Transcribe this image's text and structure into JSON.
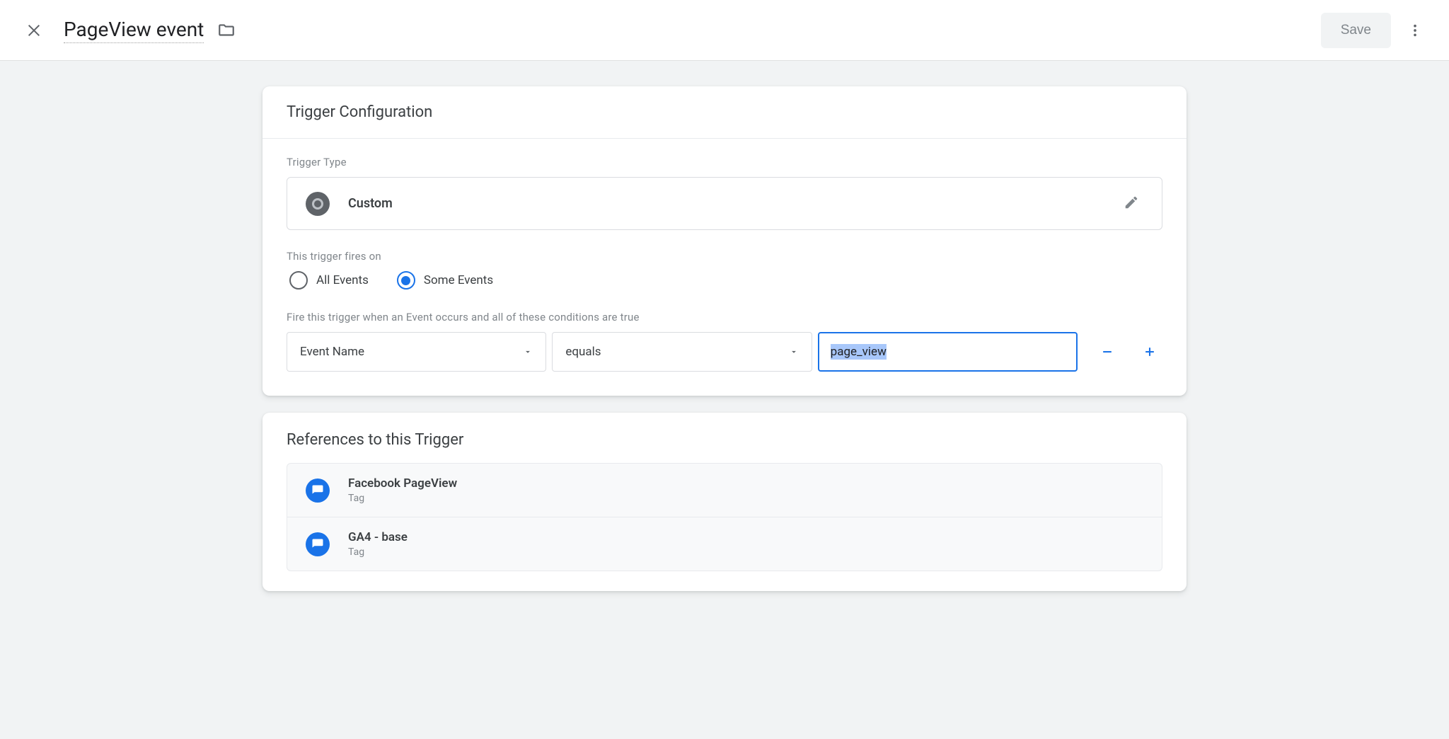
{
  "header": {
    "title": "PageView event",
    "save_label": "Save"
  },
  "trigger_config": {
    "title": "Trigger Configuration",
    "type_label": "Trigger Type",
    "type_name": "Custom",
    "fires_on_label": "This trigger fires on",
    "radio_all": "All Events",
    "radio_some": "Some Events",
    "condition_label": "Fire this trigger when an Event occurs and all of these conditions are true",
    "condition": {
      "variable": "Event Name",
      "operator": "equals",
      "value": "page_view"
    }
  },
  "references": {
    "title": "References to this Trigger",
    "items": [
      {
        "name": "Facebook PageView",
        "type": "Tag"
      },
      {
        "name": "GA4 - base",
        "type": "Tag"
      }
    ]
  }
}
